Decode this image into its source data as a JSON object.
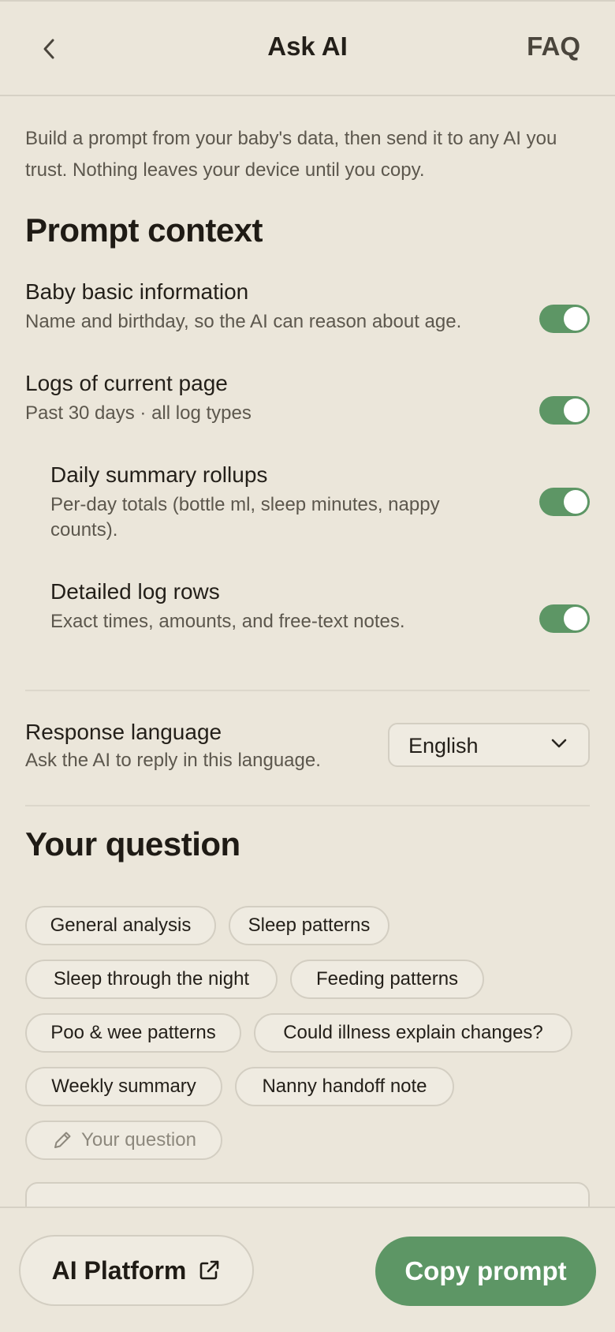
{
  "header": {
    "title": "Ask AI",
    "faq_label": "FAQ"
  },
  "intro": "Build a prompt from your baby's data, then send it to any AI you trust. Nothing leaves your device until you copy.",
  "prompt_context": {
    "title": "Prompt context",
    "options": [
      {
        "title": "Baby basic information",
        "desc": "Name and birthday, so the AI can reason about age.",
        "enabled": true
      },
      {
        "title": "Logs of current page",
        "desc": "Past 30 days · all log types",
        "enabled": true
      },
      {
        "title": "Daily summary rollups",
        "desc": "Per-day totals (bottle ml, sleep minutes, nappy counts).",
        "enabled": true
      },
      {
        "title": "Detailed log rows",
        "desc": "Exact times, amounts, and free-text notes.",
        "enabled": true
      }
    ],
    "language": {
      "title": "Response language",
      "desc": "Ask the AI to reply in this language.",
      "selected": "English"
    }
  },
  "question": {
    "title": "Your question",
    "chips": [
      "General analysis",
      "Sleep patterns",
      "Sleep through the night",
      "Feeding patterns",
      "Poo & wee patterns",
      "Could illness explain changes?",
      "Weekly summary",
      "Nanny handoff note"
    ],
    "custom_chip": "Your question"
  },
  "footer": {
    "platform_label": "AI Platform",
    "copy_label": "Copy prompt"
  },
  "colors": {
    "accent": "#5d9665",
    "background": "#ebe6da"
  }
}
